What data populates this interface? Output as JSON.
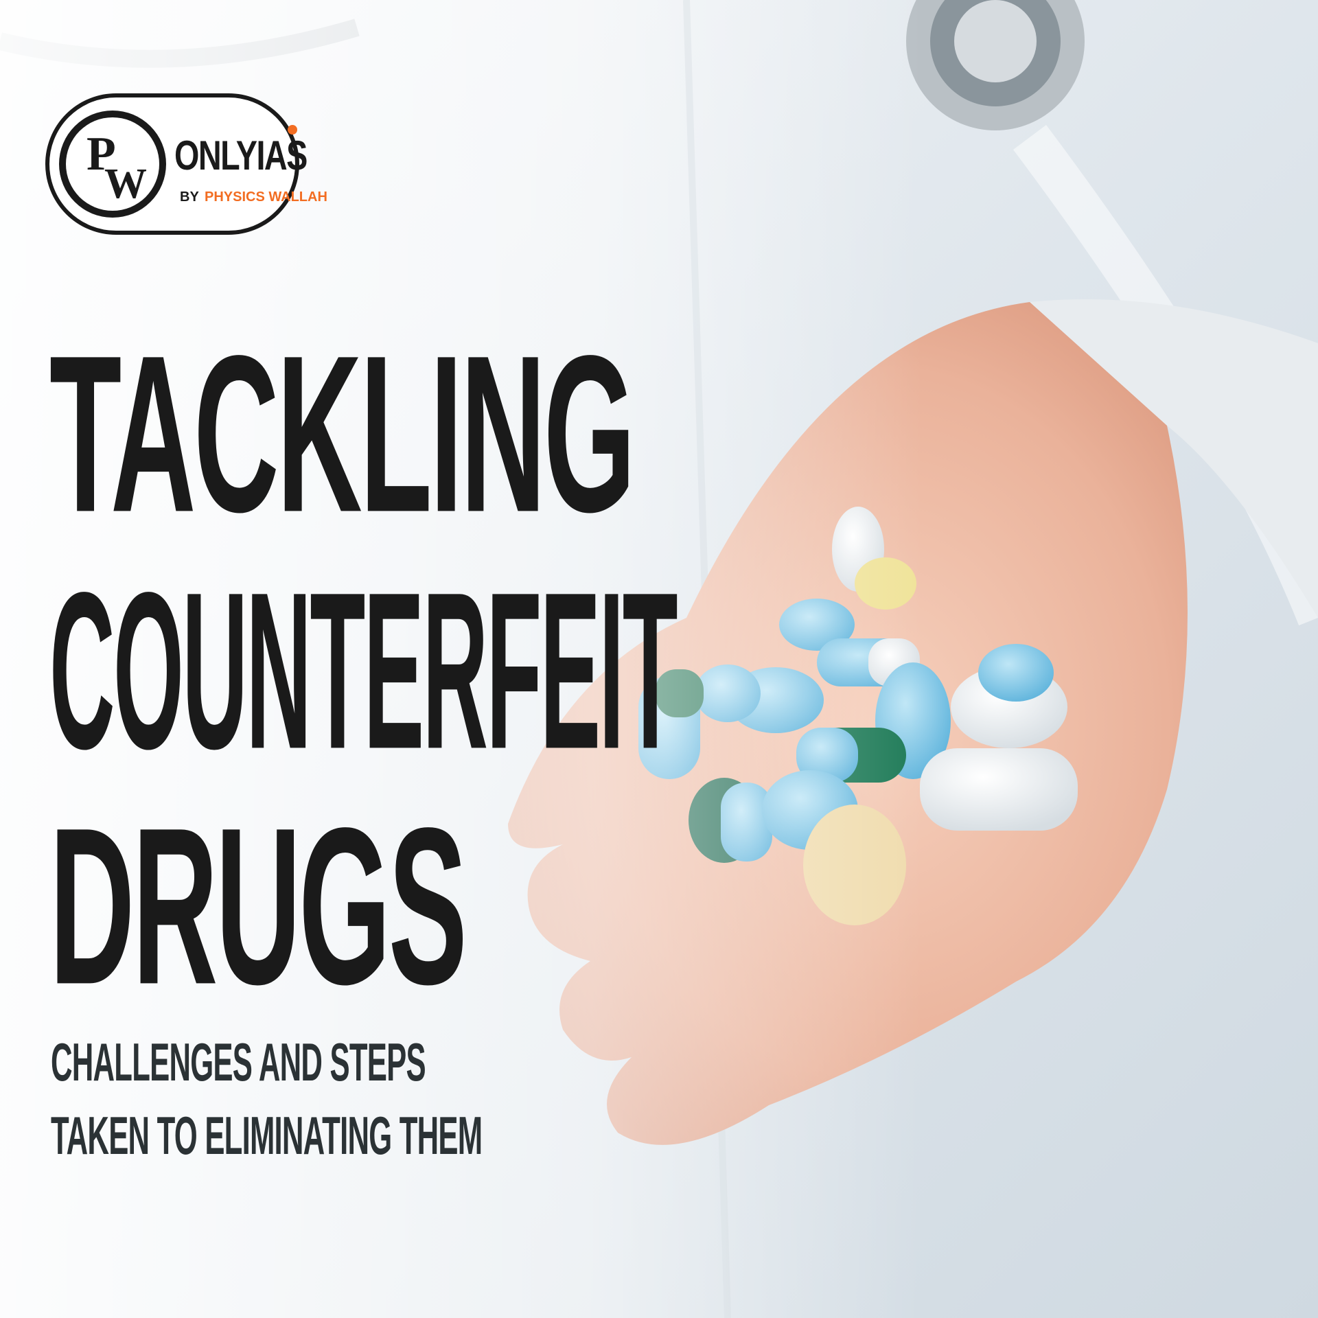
{
  "logo": {
    "initials_top": "P",
    "initials_bottom": "W",
    "brand": "ONLYIAS",
    "byline_by": "BY",
    "byline_name": "PHYSICS WALLAH"
  },
  "title": {
    "line1": "TACKLING",
    "line2": "COUNTERFEIT",
    "line3": "DRUGS"
  },
  "subtitle": {
    "line1": "CHALLENGES AND STEPS",
    "line2": "TAKEN TO ELIMINATING THEM"
  },
  "colors": {
    "title_text": "#1a1a1a",
    "brand_accent": "#f26d22"
  },
  "icons": [
    "stethoscope-icon",
    "pills-icon"
  ]
}
